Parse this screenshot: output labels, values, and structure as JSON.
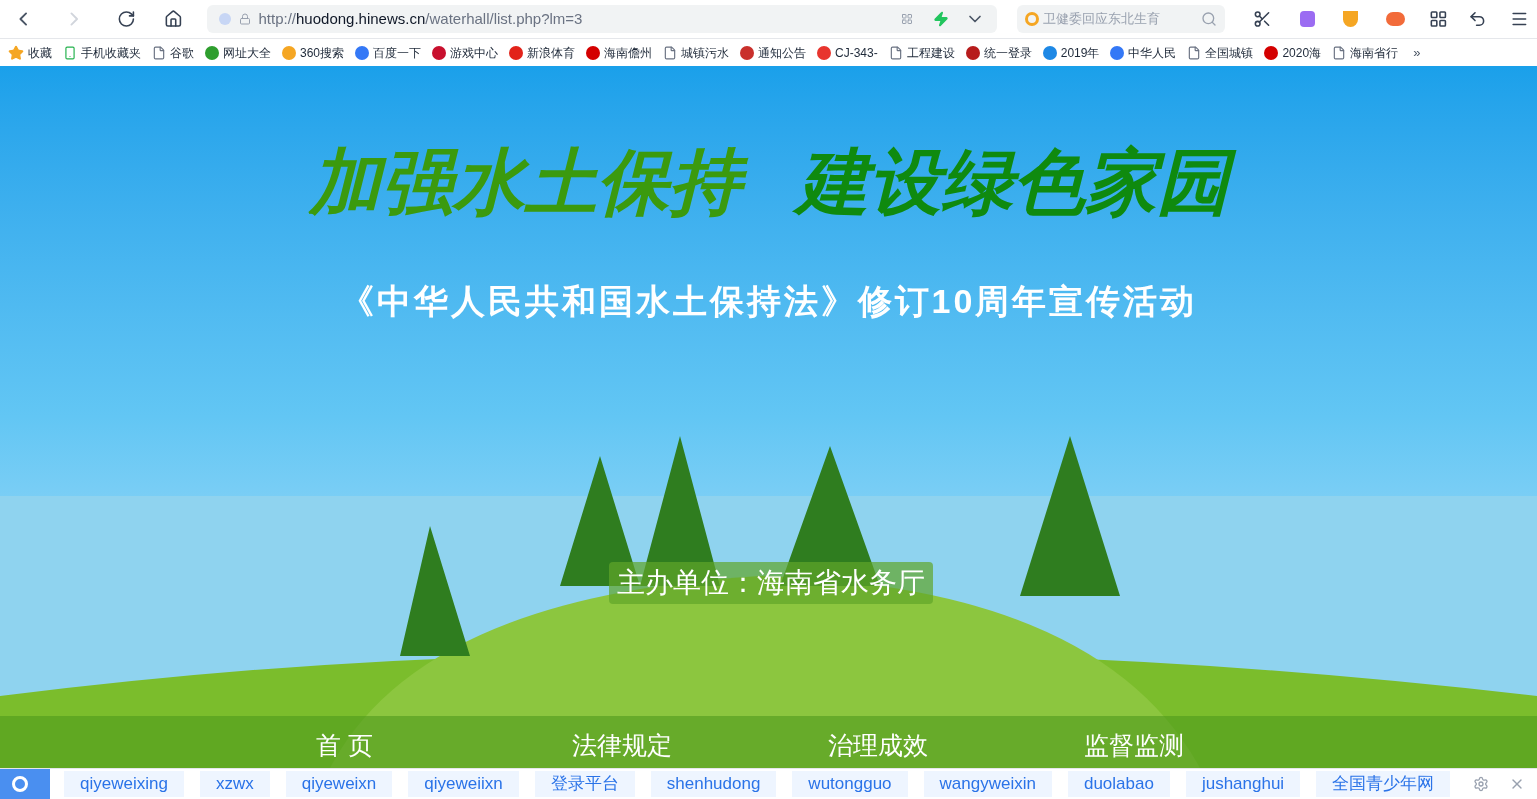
{
  "browser": {
    "url_prefix": "http://",
    "url_host": "huodong.hinews.cn",
    "url_path": "/waterhall/list.php?lm=3",
    "search_placeholder": "卫健委回应东北生育"
  },
  "bookmarks": [
    {
      "label": "收藏",
      "kind": "star"
    },
    {
      "label": "手机收藏夹",
      "kind": "phone"
    },
    {
      "label": "谷歌",
      "kind": "page"
    },
    {
      "label": "网址大全",
      "kind": "site",
      "color": "#2e9e2e"
    },
    {
      "label": "360搜索",
      "kind": "site",
      "color": "#f5a623"
    },
    {
      "label": "百度一下",
      "kind": "site",
      "color": "#3478f6"
    },
    {
      "label": "游戏中心",
      "kind": "site",
      "color": "#c8102e"
    },
    {
      "label": "新浪体育",
      "kind": "site",
      "color": "#e2231a"
    },
    {
      "label": "海南儋州",
      "kind": "site",
      "color": "#d40000"
    },
    {
      "label": "城镇污水",
      "kind": "page"
    },
    {
      "label": "通知公告",
      "kind": "site",
      "color": "#c9302c"
    },
    {
      "label": "CJ-343-",
      "kind": "site",
      "color": "#e8352e"
    },
    {
      "label": "工程建设",
      "kind": "page"
    },
    {
      "label": "统一登录",
      "kind": "site",
      "color": "#b71c1c"
    },
    {
      "label": "2019年",
      "kind": "site",
      "color": "#1e88e5"
    },
    {
      "label": "中华人民",
      "kind": "site",
      "color": "#3478f6"
    },
    {
      "label": "全国城镇",
      "kind": "page"
    },
    {
      "label": "2020海",
      "kind": "site",
      "color": "#d40000"
    },
    {
      "label": "海南省行",
      "kind": "page"
    }
  ],
  "bookmarks_more": "»",
  "hero": {
    "title_left": "加强水土保持",
    "title_right": "建设绿色家园",
    "subtitle": "《中华人民共和国水土保持法》修订10周年宣传活动",
    "organizer": "主办单位：海南省水务厅"
  },
  "nav": [
    "首 页",
    "法律规定",
    "治理成效",
    "监督监测"
  ],
  "bottom_links": [
    "qiyeweixing",
    "xzwx",
    "qiyeweixn",
    "qiyeweiixn",
    "登录平台",
    "shenhudong",
    "wutongguo",
    "wangyweixin",
    "duolabao",
    "jushanghui",
    "全国青少年网"
  ]
}
